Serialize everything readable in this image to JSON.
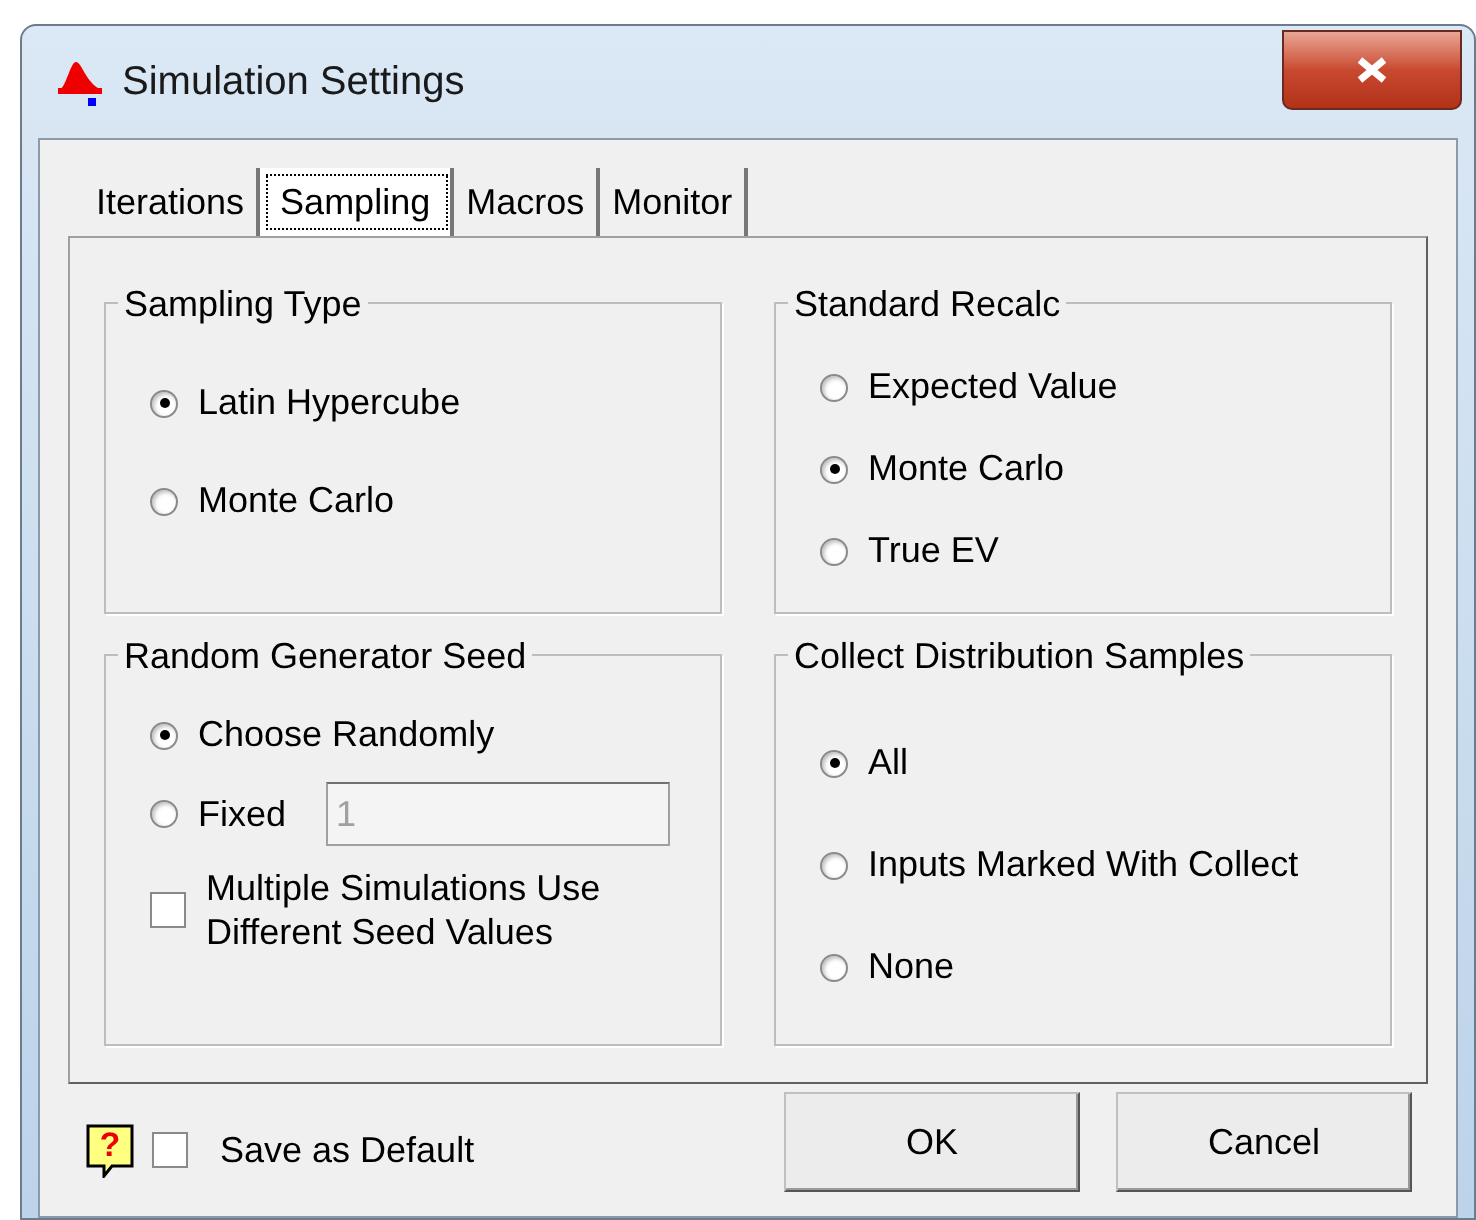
{
  "window": {
    "title": "Simulation Settings"
  },
  "tabs": [
    {
      "label": "Iterations",
      "selected": false
    },
    {
      "label": "Sampling",
      "selected": true
    },
    {
      "label": "Macros",
      "selected": false
    },
    {
      "label": "Monitor",
      "selected": false
    }
  ],
  "groups": [
    {
      "title": "Sampling Type",
      "items": [
        {
          "kind": "radio",
          "label": "Latin Hypercube",
          "selected": true
        },
        {
          "kind": "radio",
          "label": "Monte Carlo",
          "selected": false
        }
      ]
    },
    {
      "title": "Standard Recalc",
      "items": [
        {
          "kind": "radio",
          "label": "Expected Value",
          "selected": false
        },
        {
          "kind": "radio",
          "label": "Monte Carlo",
          "selected": true
        },
        {
          "kind": "radio",
          "label": "True EV",
          "selected": false
        }
      ]
    },
    {
      "title": "Random Generator Seed",
      "items": [
        {
          "kind": "radio",
          "label": "Choose Randomly",
          "selected": true
        },
        {
          "kind": "radio",
          "label": "Fixed",
          "selected": false,
          "field": {
            "value": "1",
            "disabled": true
          }
        },
        {
          "kind": "checkbox",
          "label": "Multiple Simulations Use Different Seed Values",
          "checked": false
        }
      ]
    },
    {
      "title": "Collect Distribution Samples",
      "items": [
        {
          "kind": "radio",
          "label": "All",
          "selected": true
        },
        {
          "kind": "radio",
          "label": "Inputs Marked With Collect",
          "selected": false
        },
        {
          "kind": "radio",
          "label": "None",
          "selected": false
        }
      ]
    }
  ],
  "footer": {
    "help": "?",
    "save_default": {
      "label": "Save as Default",
      "checked": false
    },
    "buttons": [
      "OK",
      "Cancel"
    ]
  }
}
